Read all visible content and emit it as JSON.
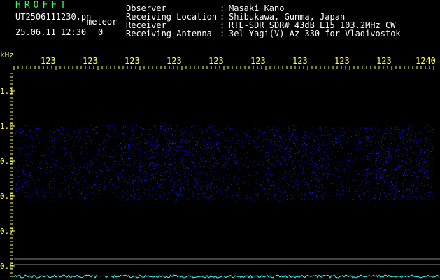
{
  "header": {
    "title": "HROFFT",
    "filename": "UT2506111230.pn",
    "mode": "meteor",
    "datetime": "25.06.11 12:30",
    "count": "0"
  },
  "info": [
    {
      "label": "Observer",
      "sep": ":",
      "value": "Masaki Kano"
    },
    {
      "label": "Receiving Location",
      "sep": ":",
      "value": "Shibukawa, Gunma, Japan"
    },
    {
      "label": "Receiver",
      "sep": ":",
      "value": "RTL-SDR SDR# 43dB L15 103.2MHz CW"
    },
    {
      "label": "Receiving Antenna",
      "sep": ":",
      "value": "3el Yagi(V) Az 330 for Vladivostok"
    }
  ],
  "axes": {
    "y_unit": "kHz",
    "x_ticks": [
      "123",
      "123",
      "123",
      "123",
      "123",
      "123",
      "123",
      "123",
      "123",
      "1240"
    ],
    "y_ticks": [
      "1.1",
      "1.0",
      "0.9",
      "0.8",
      "0.7",
      "0.6"
    ]
  },
  "colors": {
    "background": "#000000",
    "header_title": "#33ff55",
    "axis_labels": "#ffff55",
    "signal": "#2a3cff",
    "baseline": "#33ffff"
  }
}
